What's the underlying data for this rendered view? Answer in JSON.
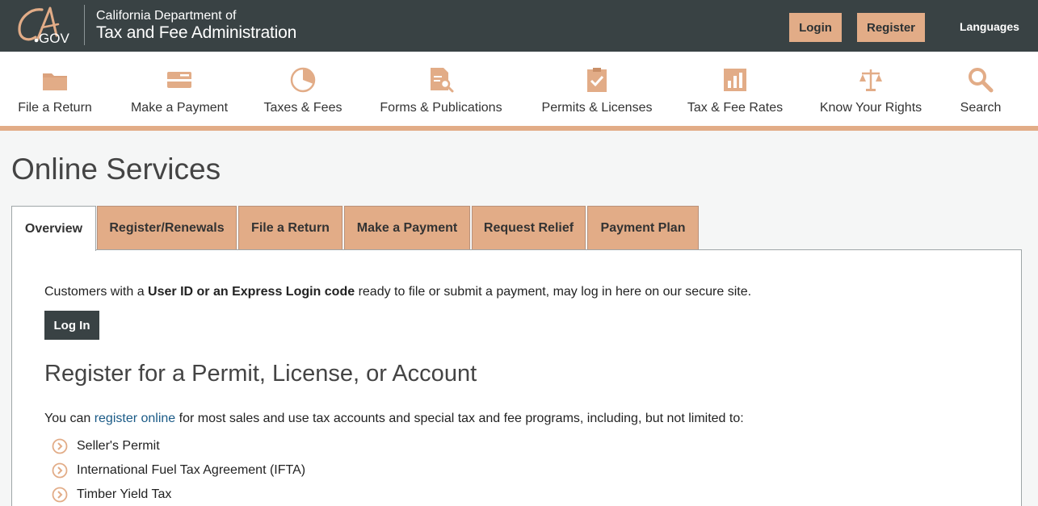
{
  "header": {
    "logo_text": "CA.GOV",
    "org_line1": "California Department of",
    "org_line2": "Tax and Fee Administration",
    "login_label": "Login",
    "register_label": "Register",
    "languages_label": "Languages"
  },
  "nav": {
    "items": [
      {
        "label": "File a Return",
        "icon": "folder-icon"
      },
      {
        "label": "Make a Payment",
        "icon": "credit-card-icon"
      },
      {
        "label": "Taxes & Fees",
        "icon": "pie-chart-icon"
      },
      {
        "label": "Forms & Publications",
        "icon": "document-search-icon"
      },
      {
        "label": "Permits & Licenses",
        "icon": "clipboard-check-icon"
      },
      {
        "label": "Tax & Fee Rates",
        "icon": "bar-chart-icon"
      },
      {
        "label": "Know Your Rights",
        "icon": "scales-icon"
      },
      {
        "label": "Search",
        "icon": "search-icon"
      }
    ]
  },
  "page": {
    "title": "Online Services"
  },
  "tabs": [
    {
      "label": "Overview",
      "active": true
    },
    {
      "label": "Register/Renewals",
      "active": false
    },
    {
      "label": "File a Return",
      "active": false
    },
    {
      "label": "Make a Payment",
      "active": false
    },
    {
      "label": "Request Relief",
      "active": false
    },
    {
      "label": "Payment Plan",
      "active": false
    }
  ],
  "content": {
    "intro_prefix": "Customers with a ",
    "intro_bold": "User ID or an Express Login code",
    "intro_suffix": " ready to file or submit a payment, may log in here on our secure site.",
    "login_button": "Log In",
    "section_title": "Register for a Permit, License, or Account",
    "desc_prefix": "You can ",
    "desc_link": "register online",
    "desc_suffix": " for most sales and use tax accounts and special tax and fee programs, including, but not limited to:",
    "list": [
      "Seller's Permit",
      "International Fuel Tax Agreement (IFTA)",
      "Timber Yield Tax"
    ]
  },
  "colors": {
    "header_bg": "#394244",
    "accent": "#e2ac87",
    "link": "#1a5a86"
  }
}
